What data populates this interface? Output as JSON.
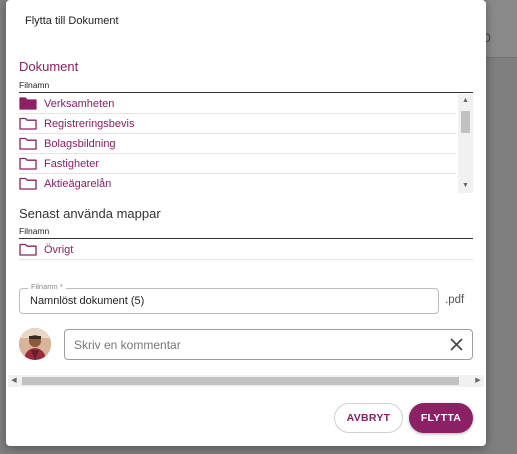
{
  "background": {
    "fragment": "0"
  },
  "dialog": {
    "title": "Flytta till Dokument",
    "documents": {
      "title": "Dokument",
      "column": "Filnamn",
      "folders": [
        {
          "name": "Verksamheten",
          "icon": "folder-filled-icon"
        },
        {
          "name": "Registreringsbevis",
          "icon": "folder-icon"
        },
        {
          "name": "Bolagsbildning",
          "icon": "folder-icon"
        },
        {
          "name": "Fastigheter",
          "icon": "folder-icon"
        },
        {
          "name": "Aktieägarelån",
          "icon": "folder-icon"
        }
      ]
    },
    "recent": {
      "title": "Senast använda mappar",
      "column": "Filnamn",
      "folders": [
        {
          "name": "Övrigt",
          "icon": "folder-icon"
        }
      ]
    },
    "filename": {
      "label": "Filnamn *",
      "value": "Namnlöst dokument (5)",
      "extension": ".pdf"
    },
    "comment": {
      "placeholder": "Skriv en kommentar"
    },
    "buttons": {
      "cancel": "AVBRYT",
      "move": "FLYTTA"
    },
    "colors": {
      "accent": "#8c2064"
    }
  }
}
